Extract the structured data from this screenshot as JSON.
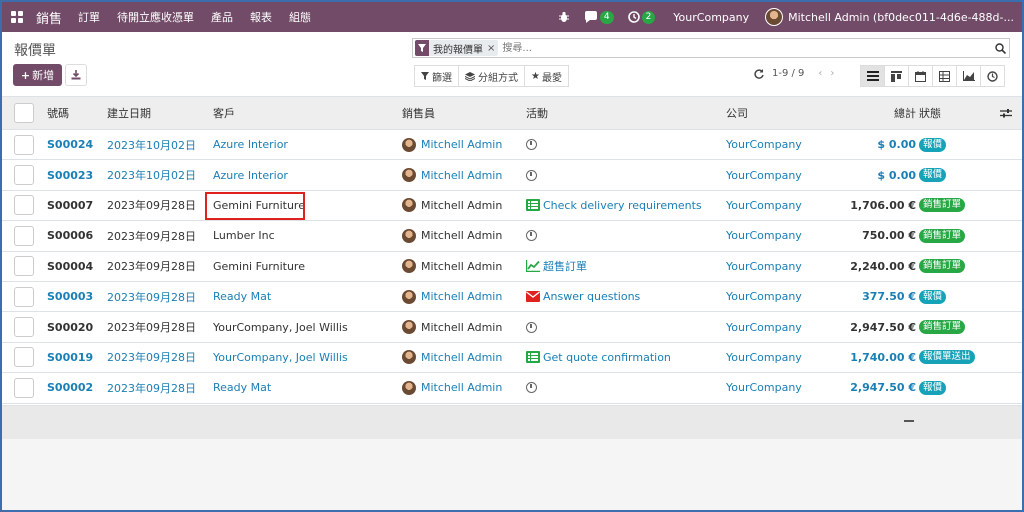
{
  "nav": {
    "brand": "銷售",
    "menu": [
      "訂單",
      "待開立應收憑單",
      "產品",
      "報表",
      "組態"
    ],
    "chat_count": "4",
    "activity_count": "2",
    "company": "YourCompany",
    "user": "Mitchell Admin (bf0dec011-4d6e-488d-..."
  },
  "control": {
    "title": "報價單",
    "new_label": "新增",
    "facet": "我的報價單",
    "search_placeholder": "搜尋...",
    "filters_label": "篩選",
    "groupby_label": "分組方式",
    "favorites_label": "最愛",
    "pager": "1-9 / 9"
  },
  "columns": {
    "number": "號碼",
    "date": "建立日期",
    "customer": "客戶",
    "salesperson": "銷售員",
    "activity": "活動",
    "company": "公司",
    "total": "總計",
    "status": "狀態"
  },
  "rows": [
    {
      "number": "S00024",
      "date": "2023年10月02日",
      "customer": "Azure Interior",
      "salesperson": "Mitchell Admin",
      "activity_icon": "clock-icon",
      "activity": "",
      "company": "YourCompany",
      "total": "$ 0.00",
      "status": "報價",
      "status_type": "quote",
      "style": "blue"
    },
    {
      "number": "S00023",
      "date": "2023年10月02日",
      "customer": "Azure Interior",
      "salesperson": "Mitchell Admin",
      "activity_icon": "clock-icon",
      "activity": "",
      "company": "YourCompany",
      "total": "$ 0.00",
      "status": "報價",
      "status_type": "quote",
      "style": "blue"
    },
    {
      "number": "S00007",
      "date": "2023年09月28日",
      "customer": "Gemini Furniture",
      "salesperson": "Mitchell Admin",
      "activity_icon": "list-icon",
      "activity": "Check delivery requirements",
      "company": "YourCompany",
      "total": "1,706.00 €",
      "status": "銷售訂單",
      "status_type": "order",
      "style": "black"
    },
    {
      "number": "S00006",
      "date": "2023年09月28日",
      "customer": "Lumber Inc",
      "salesperson": "Mitchell Admin",
      "activity_icon": "clock-icon",
      "activity": "",
      "company": "YourCompany",
      "total": "750.00 €",
      "status": "銷售訂單",
      "status_type": "order",
      "style": "black"
    },
    {
      "number": "S00004",
      "date": "2023年09月28日",
      "customer": "Gemini Furniture",
      "salesperson": "Mitchell Admin",
      "activity_icon": "chart-line-icon",
      "activity": "超售訂單",
      "company": "YourCompany",
      "total": "2,240.00 €",
      "status": "銷售訂單",
      "status_type": "order",
      "style": "black"
    },
    {
      "number": "S00003",
      "date": "2023年09月28日",
      "customer": "Ready Mat",
      "salesperson": "Mitchell Admin",
      "activity_icon": "envelope-icon",
      "activity": "Answer questions",
      "company": "YourCompany",
      "total": "377.50 €",
      "status": "報價",
      "status_type": "quote",
      "style": "blue"
    },
    {
      "number": "S00020",
      "date": "2023年09月28日",
      "customer": "YourCompany, Joel Willis",
      "salesperson": "Mitchell Admin",
      "activity_icon": "clock-icon",
      "activity": "",
      "company": "YourCompany",
      "total": "2,947.50 €",
      "status": "銷售訂單",
      "status_type": "order",
      "style": "black"
    },
    {
      "number": "S00019",
      "date": "2023年09月28日",
      "customer": "YourCompany, Joel Willis",
      "salesperson": "Mitchell Admin",
      "activity_icon": "list-icon",
      "activity": "Get quote confirmation",
      "company": "YourCompany",
      "total": "1,740.00 €",
      "status": "報價單送出",
      "status_type": "quote",
      "style": "blue"
    },
    {
      "number": "S00002",
      "date": "2023年09月28日",
      "customer": "Ready Mat",
      "salesperson": "Mitchell Admin",
      "activity_icon": "clock-icon",
      "activity": "",
      "company": "YourCompany",
      "total": "2,947.50 €",
      "status": "報價",
      "status_type": "quote",
      "style": "blue"
    }
  ],
  "colors": {
    "brand": "#714b67",
    "link": "#1a7fb5",
    "quote_badge": "#17a2b8",
    "order_badge": "#28a745",
    "highlight": "#e0221e"
  }
}
